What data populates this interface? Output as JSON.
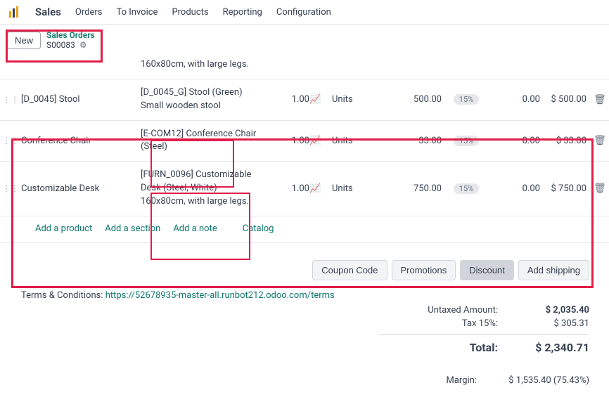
{
  "nav": {
    "brand": "Sales",
    "items": [
      "Orders",
      "To Invoice",
      "Products",
      "Reporting",
      "Configuration"
    ]
  },
  "subheader": {
    "new_label": "New",
    "crumb_top": "Sales Orders",
    "crumb_id": "S00083"
  },
  "lines": [
    {
      "product": "",
      "desc": "160x80cm, with large legs.",
      "qty": "",
      "uom": "",
      "price": "",
      "discount": "",
      "tax": "",
      "subtotal": "",
      "show_icons": false
    },
    {
      "product": "[D_0045] Stool",
      "desc": "[D_0045_G] Stool (Green)\nSmall wooden stool",
      "qty": "1.00",
      "uom": "Units",
      "price": "500.00",
      "discount": "15%",
      "tax": "0.00",
      "subtotal": "$ 500.00",
      "show_icons": true
    },
    {
      "product": "Conference Chair",
      "desc": "[E-COM12] Conference Chair (Steel)",
      "qty": "1.00",
      "uom": "Units",
      "price": "33.00",
      "discount": "15%",
      "tax": "0.00",
      "subtotal": "$ 33.00",
      "show_icons": true
    },
    {
      "product": "Customizable Desk",
      "desc": "[FURN_0096] Customizable Desk (Steel, White)\n160x80cm, with large legs.",
      "qty": "1.00",
      "uom": "Units",
      "price": "750.00",
      "discount": "15%",
      "tax": "0.00",
      "subtotal": "$ 750.00",
      "show_icons": true
    }
  ],
  "add_links": {
    "product": "Add a product",
    "section": "Add a section",
    "note": "Add a note",
    "catalog": "Catalog"
  },
  "buttons": {
    "coupon": "Coupon Code",
    "promotions": "Promotions",
    "discount": "Discount",
    "shipping": "Add shipping"
  },
  "terms": {
    "label": "Terms & Conditions: ",
    "url_text": "https://52678935-master-all.runbot212.odoo.com/terms"
  },
  "totals": {
    "untaxed_label": "Untaxed Amount:",
    "untaxed_value": "$ 2,035.40",
    "tax_label": "Tax 15%:",
    "tax_value": "$ 305.31",
    "total_label": "Total:",
    "total_value": "$ 2,340.71",
    "margin_label": "Margin:",
    "margin_value": "$ 1,535.40 (75.43%)"
  }
}
